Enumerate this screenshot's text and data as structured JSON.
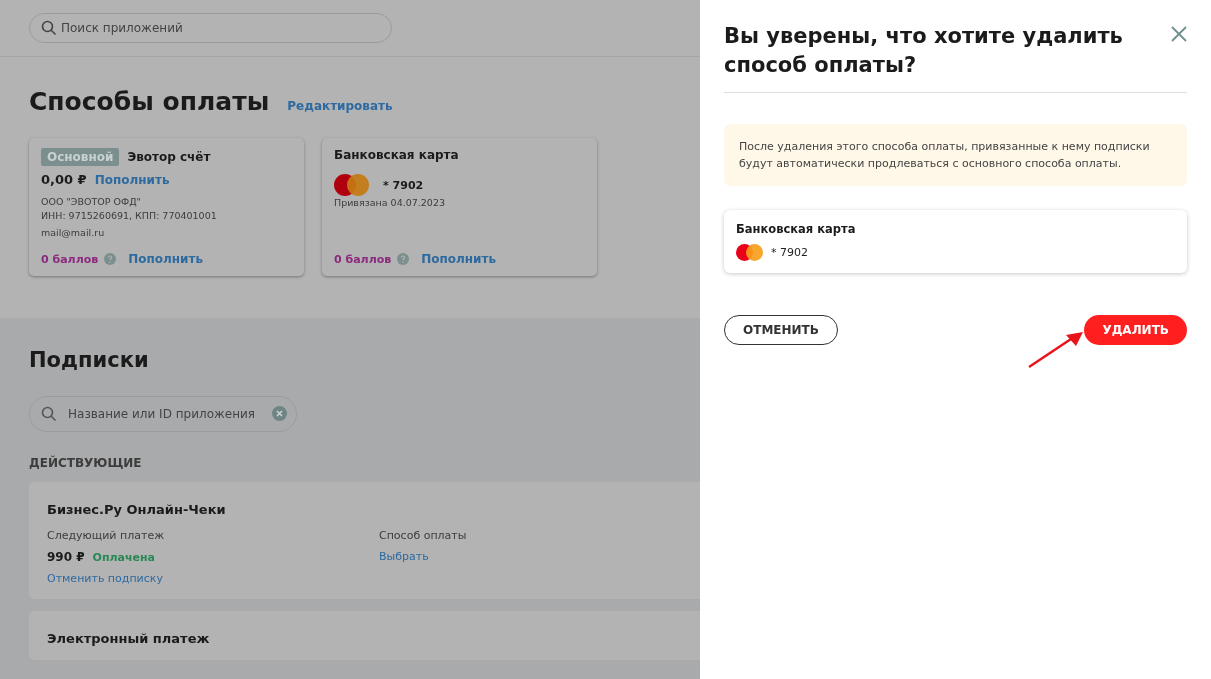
{
  "search": {
    "placeholder": "Поиск приложений"
  },
  "payment_methods": {
    "title": "Способы оплаты",
    "edit_link": "Редактировать",
    "cards": [
      {
        "kind": "account",
        "badge": "Основной",
        "name": "Эвотор счёт",
        "balance": "0,00 ₽",
        "topup": "Пополнить",
        "details": [
          "ООО \"ЭВОТОР ОФД\"",
          "ИНН: 9715260691, КПП: 770401001"
        ],
        "email": "mail@mail.ru",
        "points": "0 баллов",
        "points_topup": "Пополнить"
      },
      {
        "kind": "card",
        "name": "Банковская карта",
        "number": "* 7902",
        "linked": "Привязана 04.07.2023",
        "points": "0 баллов",
        "points_topup": "Пополнить"
      }
    ]
  },
  "subscriptions": {
    "title": "Подписки",
    "search": {
      "placeholder": "Название или ID приложения"
    },
    "group": "ДЕЙСТВУЮЩИЕ",
    "items": [
      {
        "name": "Бизнес.Ру Онлайн-Чеки",
        "next_label": "Следующий платеж",
        "price": "990 ₽",
        "status": "Оплачена",
        "cancel": "Отменить подписку",
        "method_label": "Способ оплаты",
        "method_link": "Выбрать"
      },
      {
        "name": "Электронный платеж"
      }
    ]
  },
  "dialog": {
    "title": "Вы уверены, что хотите удалить способ оплаты?",
    "notice": "После удаления этого способа оплаты, привязанные к нему подписки будут автоматически продлеваться с основного способа оплаты.",
    "card": {
      "name": "Банковская карта",
      "number": "* 7902"
    },
    "buttons": [
      {
        "label": "ОТМЕНИТЬ",
        "kind": "secondary"
      },
      {
        "label": "УДАЛИТЬ",
        "kind": "danger"
      }
    ]
  }
}
